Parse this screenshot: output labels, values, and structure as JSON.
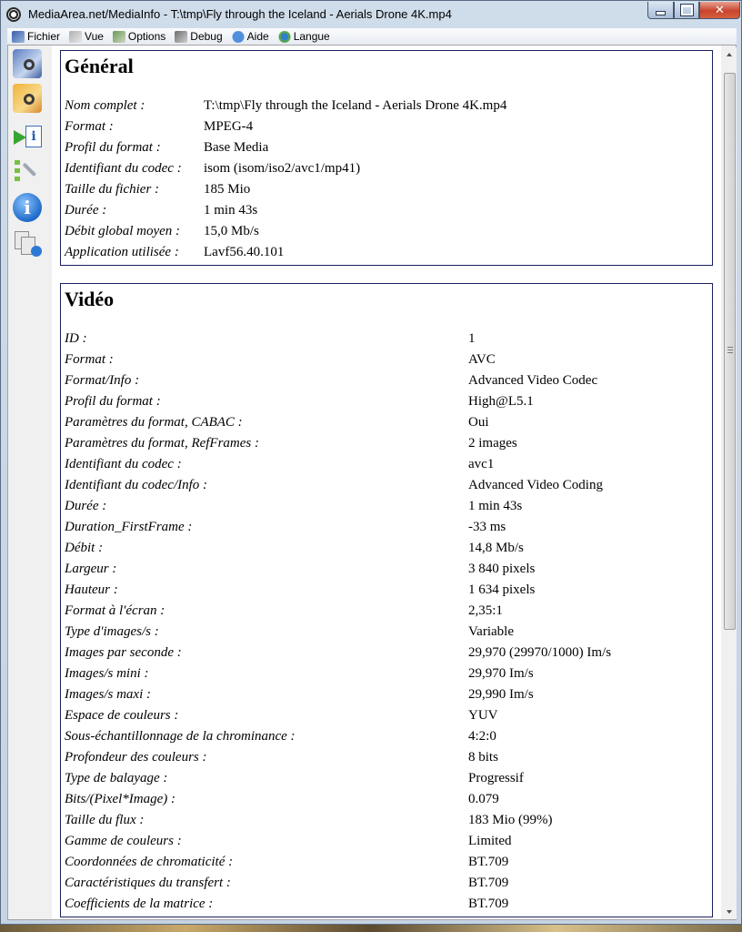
{
  "window": {
    "title": "MediaArea.net/MediaInfo - T:\\tmp\\Fly through the Iceland - Aerials Drone 4K.mp4"
  },
  "menu": [
    {
      "label": "Fichier",
      "icon": "file-icon"
    },
    {
      "label": "Vue",
      "icon": "view-icon"
    },
    {
      "label": "Options",
      "icon": "options-icon"
    },
    {
      "label": "Debug",
      "icon": "debug-icon"
    },
    {
      "label": "Aide",
      "icon": "help-icon"
    },
    {
      "label": "Langue",
      "icon": "language-icon"
    }
  ],
  "toolbar": [
    {
      "icon": "open-file-icon"
    },
    {
      "icon": "open-folder-icon"
    },
    {
      "icon": "export-icon"
    },
    {
      "icon": "preferences-icon"
    },
    {
      "icon": "about-icon"
    },
    {
      "icon": "copy-icon"
    }
  ],
  "general": {
    "title": "Général",
    "rows": [
      {
        "key": "Nom complet :",
        "value": "T:\\tmp\\Fly through the Iceland - Aerials Drone 4K.mp4"
      },
      {
        "key": "Format :",
        "value": "MPEG-4"
      },
      {
        "key": "Profil du format :",
        "value": "Base Media"
      },
      {
        "key": "Identifiant du codec :",
        "value": "isom (isom/iso2/avc1/mp41)"
      },
      {
        "key": "Taille du fichier :",
        "value": "185 Mio"
      },
      {
        "key": "Durée :",
        "value": "1 min 43s"
      },
      {
        "key": "Débit global moyen :",
        "value": "15,0 Mb/s"
      },
      {
        "key": "Application utilisée :",
        "value": "Lavf56.40.101"
      }
    ]
  },
  "video": {
    "title": "Vidéo",
    "rows": [
      {
        "key": "ID :",
        "value": "1"
      },
      {
        "key": "Format :",
        "value": "AVC"
      },
      {
        "key": "Format/Info :",
        "value": "Advanced Video Codec"
      },
      {
        "key": "Profil du format :",
        "value": "High@L5.1"
      },
      {
        "key": "Paramètres du format, CABAC :",
        "value": "Oui"
      },
      {
        "key": "Paramètres du format, RefFrames :",
        "value": "2 images"
      },
      {
        "key": "Identifiant du codec :",
        "value": "avc1"
      },
      {
        "key": "Identifiant du codec/Info :",
        "value": "Advanced Video Coding"
      },
      {
        "key": "Durée :",
        "value": "1 min 43s"
      },
      {
        "key": "Duration_FirstFrame :",
        "value": "-33 ms"
      },
      {
        "key": "Débit :",
        "value": "14,8 Mb/s"
      },
      {
        "key": "Largeur :",
        "value": "3 840 pixels"
      },
      {
        "key": "Hauteur :",
        "value": "1 634 pixels"
      },
      {
        "key": "Format à l'écran :",
        "value": "2,35:1"
      },
      {
        "key": "Type d'images/s :",
        "value": "Variable"
      },
      {
        "key": "Images par seconde :",
        "value": "29,970 (29970/1000) Im/s"
      },
      {
        "key": "Images/s mini :",
        "value": "29,970 Im/s"
      },
      {
        "key": "Images/s maxi :",
        "value": "29,990 Im/s"
      },
      {
        "key": "Espace de couleurs :",
        "value": "YUV"
      },
      {
        "key": "Sous-échantillonnage de la chrominance :",
        "value": "4:2:0"
      },
      {
        "key": "Profondeur des couleurs :",
        "value": "8 bits"
      },
      {
        "key": "Type de balayage :",
        "value": "Progressif"
      },
      {
        "key": "Bits/(Pixel*Image) :",
        "value": "0.079"
      },
      {
        "key": "Taille du flux :",
        "value": "183 Mio (99%)"
      },
      {
        "key": "Gamme de couleurs :",
        "value": "Limited"
      },
      {
        "key": "Coordonnées de chromaticité :",
        "value": "BT.709"
      },
      {
        "key": "Caractéristiques du transfert :",
        "value": "BT.709"
      },
      {
        "key": "Coefficients de la matrice :",
        "value": "BT.709"
      }
    ]
  }
}
